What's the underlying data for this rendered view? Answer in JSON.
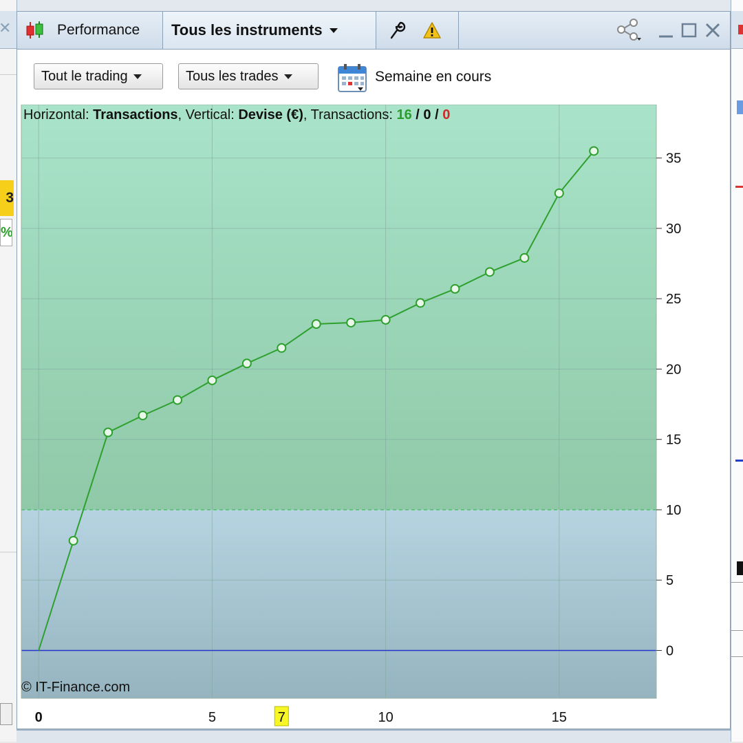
{
  "window": {
    "module_title": "Performance",
    "instrument_selector": "Tous les instruments"
  },
  "filters": {
    "trading_filter": "Tout le trading",
    "trades_filter": "Tous les trades",
    "period_label": "Semaine en cours"
  },
  "chart_header": {
    "horizontal_label": "Horizontal: ",
    "horizontal_value": "Transactions",
    "vertical_label": ", Vertical: ",
    "vertical_value": "Devise (€)",
    "transactions_label": ", Transactions: ",
    "count_green": "16",
    "count_neutral": "0",
    "count_red": "0",
    "sep1": " / ",
    "sep2": " / "
  },
  "copyright": "© IT-Finance.com",
  "background": {
    "left_badge": "3",
    "left_pct": "%"
  },
  "colors": {
    "profit_zone": "#a9e3c9",
    "profit_zone_bottom": "#8fc9a8",
    "lower_zone": "#b5d3e0",
    "lower_zone_bottom": "#96b4c0",
    "line": "#2ea02e",
    "zero_line": "#2336c8",
    "highlight": "#f7f727"
  },
  "chart_data": {
    "type": "line",
    "x": [
      0,
      1,
      2,
      3,
      4,
      5,
      6,
      7,
      8,
      9,
      10,
      11,
      12,
      13,
      14,
      15,
      16
    ],
    "series": [
      {
        "values": [
          0,
          7.8,
          15.5,
          16.7,
          17.8,
          19.2,
          20.4,
          21.5,
          23.2,
          23.3,
          23.5,
          24.7,
          25.7,
          26.9,
          27.9,
          32.5,
          35.5
        ]
      }
    ],
    "xlim": [
      -0.5,
      17.8
    ],
    "ylim": [
      -3.4,
      38.8
    ],
    "xticks": [
      0,
      5,
      10,
      15
    ],
    "highlighted_xtick": 7,
    "yticks": [
      0,
      5,
      10,
      15,
      20,
      25,
      30,
      35
    ],
    "zone_threshold": 10,
    "grid": true
  }
}
